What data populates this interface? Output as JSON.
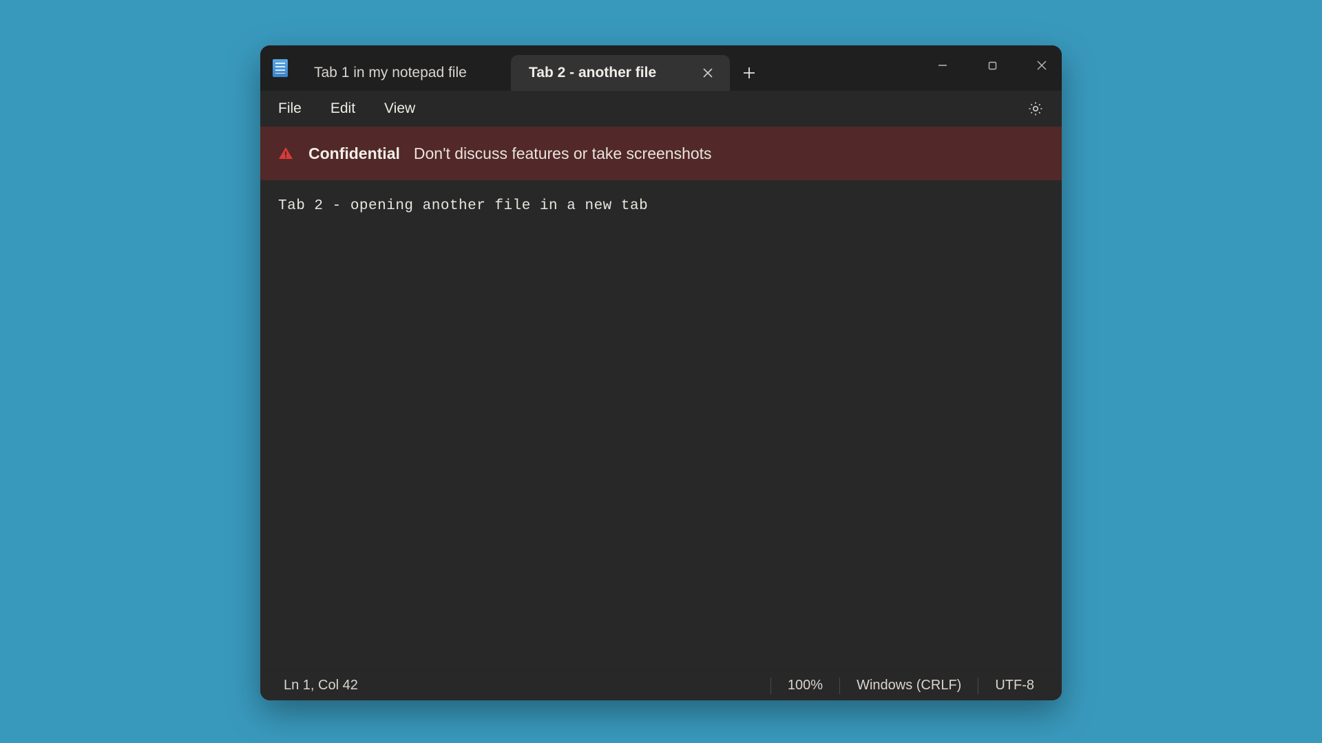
{
  "tabs": [
    {
      "label": "Tab 1 in my notepad file",
      "active": false
    },
    {
      "label": "Tab 2 - another file",
      "active": true
    }
  ],
  "menu": {
    "file": "File",
    "edit": "Edit",
    "view": "View"
  },
  "banner": {
    "title": "Confidential",
    "message": "Don't discuss features or take screenshots"
  },
  "editor": {
    "content": "Tab 2 - opening another file in a new tab"
  },
  "status": {
    "cursor": "Ln 1, Col 42",
    "zoom": "100%",
    "line_ending": "Windows (CRLF)",
    "encoding": "UTF-8"
  }
}
